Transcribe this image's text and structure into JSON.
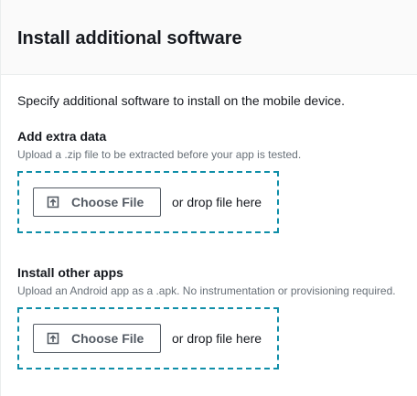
{
  "panel": {
    "title": "Install additional software",
    "description": "Specify additional software to install on the mobile device."
  },
  "extra_data": {
    "label": "Add extra data",
    "hint": "Upload a .zip file to be extracted before your app is tested.",
    "button_label": "Choose File",
    "drop_text": "or drop file here",
    "icon": "upload-icon"
  },
  "other_apps": {
    "label": "Install other apps",
    "hint": "Upload an Android app as a .apk. No instrumentation or provisioning required.",
    "button_label": "Choose File",
    "drop_text": "or drop file here",
    "icon": "upload-icon"
  },
  "colors": {
    "dropzone_border": "#0f8ea8",
    "header_bg": "#fafafa",
    "hint_text": "#687078",
    "button_border": "#545b64"
  }
}
